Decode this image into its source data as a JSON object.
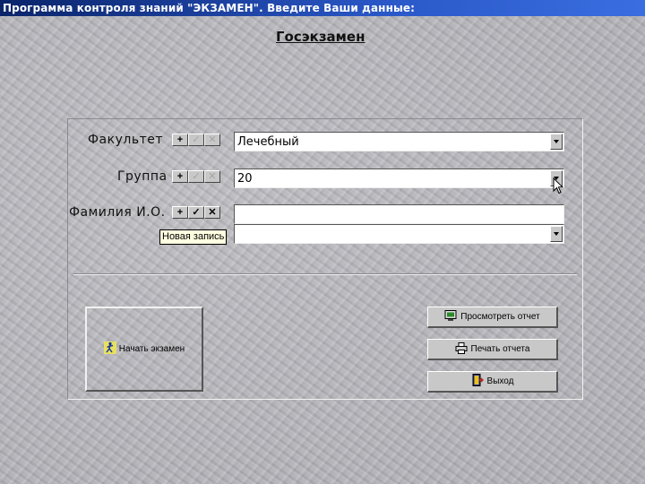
{
  "window": {
    "title": "Программа контроля знаний \"ЭКЗАМЕН\". Введите Ваши данные:"
  },
  "heading": "Госэкзамен",
  "form": {
    "faculty": {
      "label": "Факультет",
      "value": "Лечебный",
      "nav": {
        "add": "+",
        "post": "✓",
        "cancel": "✕"
      }
    },
    "group": {
      "label": "Группа",
      "value": "20",
      "nav": {
        "add": "+",
        "post": "✓",
        "cancel": "✕"
      }
    },
    "student": {
      "label": "Фамилия И.О.",
      "value": "",
      "lookup_value": "",
      "nav": {
        "add": "+",
        "post": "✓",
        "cancel": "✕"
      }
    },
    "tooltip": "Новая запись"
  },
  "actions": {
    "start_exam": "Начать экзамен",
    "view_report": "Просмотреть отчет",
    "print_report": "Печать отчета",
    "exit": "Выход"
  },
  "icons": {
    "start_exam": "running-man-icon",
    "view_report": "monitor-icon",
    "print_report": "printer-icon",
    "exit": "exit-door-icon"
  }
}
